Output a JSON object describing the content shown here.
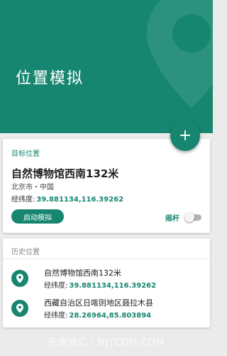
{
  "header": {
    "title": "位置模拟",
    "fab_icon": "+",
    "background_color": "#178670"
  },
  "target": {
    "section_title": "目标位置",
    "name": "自然博物馆西南132米",
    "region": "北京市・中国",
    "coords_label": "经纬度:",
    "coords_value": "39.881134,116.39262",
    "start_button": "启动模拟",
    "joystick_label": "摇杆",
    "joystick_enabled": false
  },
  "history": {
    "section_title": "历史位置",
    "items": [
      {
        "name": "自然博物馆西南132米",
        "coords_label": "经纬度:",
        "coords_value": "39.881134,116.39262"
      },
      {
        "name": "西藏自治区日喀则地区聂拉木县",
        "coords_label": "经纬度:",
        "coords_value": "28.26964,85.803894"
      }
    ]
  },
  "watermark": "乐享资汇・NJYCOH.COM",
  "colors": {
    "accent": "#178670",
    "background": "#ebebeb",
    "card": "#ffffff"
  },
  "icons": {
    "header_decoration": "map-pin-icon",
    "fab": "plus-icon",
    "history_item": "map-pin-icon"
  }
}
